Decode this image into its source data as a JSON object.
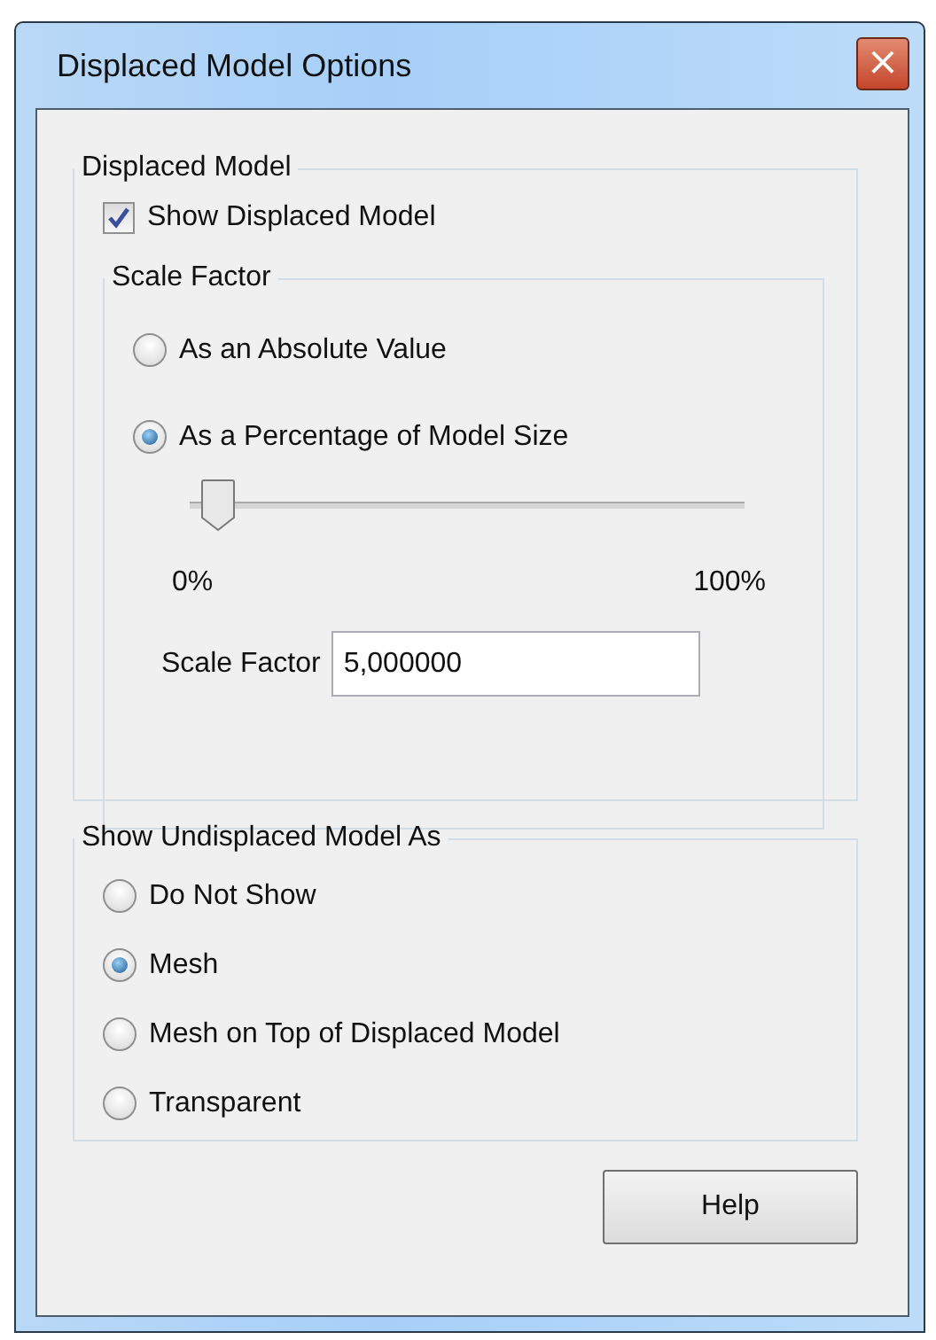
{
  "window": {
    "title": "Displaced Model Options",
    "close": "×"
  },
  "displaced_group": {
    "title": "Displaced Model",
    "show_checkbox": {
      "label": "Show Displaced Model",
      "checked": true
    },
    "scale_group": {
      "title": "Scale Factor",
      "options": [
        {
          "label": "As an Absolute Value",
          "selected": false
        },
        {
          "label": "As a Percentage of Model Size",
          "selected": true
        }
      ],
      "slider": {
        "level": 0.05,
        "min_label": "0%",
        "max_label": "100%"
      },
      "field": {
        "label": "Scale Factor",
        "value": "5,000000"
      }
    }
  },
  "undisplaced_group": {
    "title": "Show Undisplaced Model As",
    "options": [
      {
        "label": "Do Not Show",
        "selected": false
      },
      {
        "label": "Mesh",
        "selected": true
      },
      {
        "label": "Mesh on Top of Displaced Model",
        "selected": false
      },
      {
        "label": "Transparent",
        "selected": false
      }
    ]
  },
  "buttons": [
    {
      "label": "Help"
    }
  ]
}
